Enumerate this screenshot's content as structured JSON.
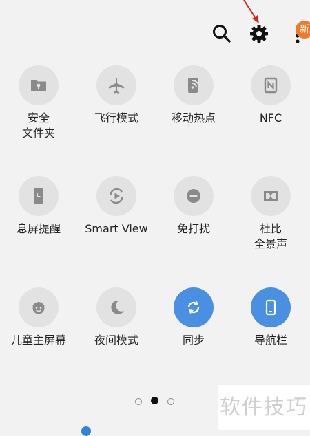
{
  "header": {
    "search_icon": "search-icon",
    "settings_icon": "gear-icon",
    "more_icon": "more-vertical-icon",
    "badge_text": "新"
  },
  "tiles": [
    {
      "icon": "secure-folder-icon",
      "label": "安全",
      "label2": "文件夹",
      "on": false
    },
    {
      "icon": "airplane-icon",
      "label": "飞行模式",
      "on": false
    },
    {
      "icon": "hotspot-icon",
      "label": "移动热点",
      "on": false
    },
    {
      "icon": "nfc-icon",
      "label": "NFC",
      "on": false
    },
    {
      "icon": "screen-reminder-icon",
      "label": "息屏提醒",
      "on": false
    },
    {
      "icon": "smart-view-icon",
      "label": "Smart View",
      "on": false
    },
    {
      "icon": "do-not-disturb-icon",
      "label": "免打扰",
      "on": false
    },
    {
      "icon": "dolby-icon",
      "label": "杜比",
      "label2": "全景声",
      "on": false
    },
    {
      "icon": "kids-home-icon",
      "label": "儿童主屏幕",
      "on": false
    },
    {
      "icon": "night-mode-icon",
      "label": "夜间模式",
      "on": false
    },
    {
      "icon": "sync-icon",
      "label": "同步",
      "on": true
    },
    {
      "icon": "navigation-bar-icon",
      "label": "导航栏",
      "on": true
    }
  ],
  "pager": {
    "pages": 3,
    "current": 2
  },
  "watermark": "软件技巧",
  "colors": {
    "active": "#4a90e2",
    "inactive_circle": "#e2e2e2",
    "background": "#f2f2f2",
    "badge": "#f07a2a",
    "arrow": "#e02020"
  }
}
